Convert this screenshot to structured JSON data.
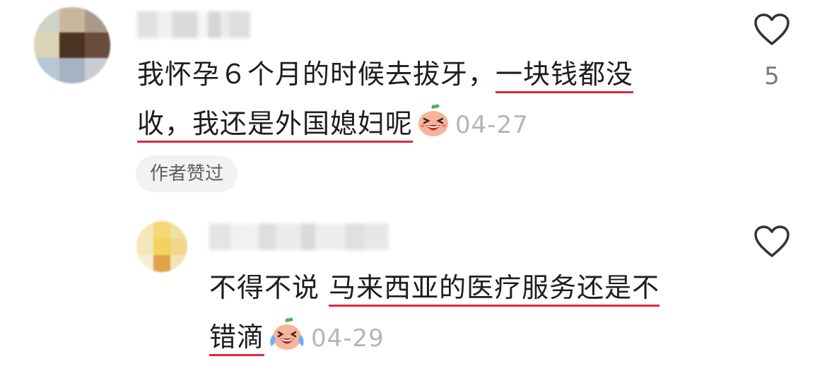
{
  "comments": [
    {
      "text_line1_plain": "我怀孕６个月的时候去拔牙，",
      "text_line1_hl": "一块钱都没",
      "text_line2_hl": "收，我还是外国媳妇呢",
      "date": "04-27",
      "badge": "作者赞过",
      "likes": "5",
      "emoji": "laughing-peach-emoji"
    },
    {
      "text_line1_plain": "不得不说 ",
      "text_line1_hl": "马来西亚的医疗服务还是不",
      "text_line2_hl": "错滴",
      "date": "04-29",
      "emoji": "crying-laughing-peach-emoji"
    }
  ],
  "colors": {
    "underline": "#e0283a",
    "date": "#b5b5b5",
    "badge_bg": "#f2f2f2"
  },
  "icons": [
    "heart-outline-icon"
  ]
}
